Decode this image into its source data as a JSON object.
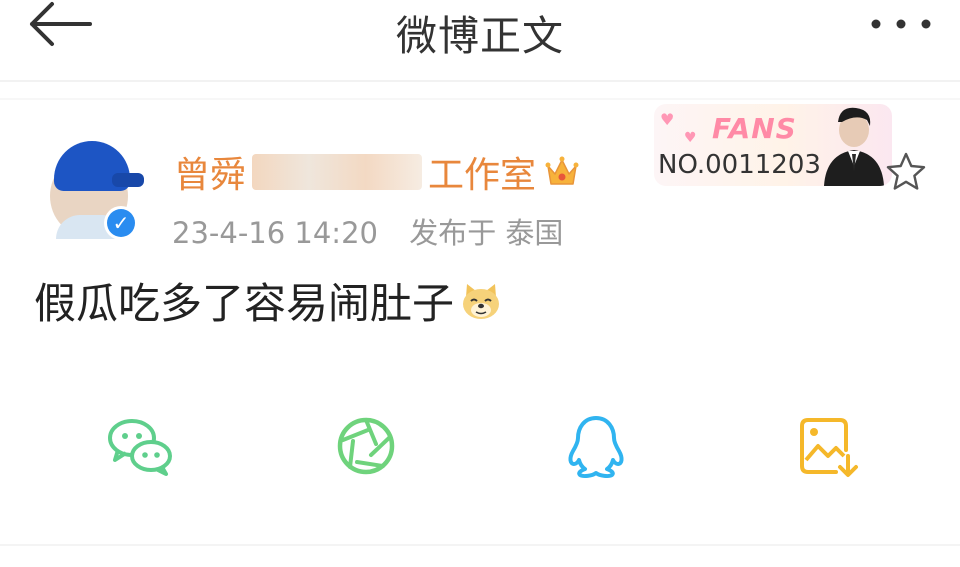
{
  "nav": {
    "title": "微博正文",
    "back_icon": "arrow-left-icon",
    "more_icon": "more-dots-icon"
  },
  "post": {
    "author": {
      "name_prefix": "曾舜",
      "name_suffix": "工作室",
      "name_color": "#e8873c",
      "verified": true,
      "badge_icon": "crown-icon"
    },
    "meta": {
      "time": "23-4-16 14:20",
      "location": "发布于 泰国"
    },
    "fans_card": {
      "label": "FANS",
      "number": "NO.0011203"
    },
    "text": "假瓜吃多了容易闹肚子",
    "emoji": "doge-icon"
  },
  "share": {
    "items": [
      {
        "name": "wechat-icon",
        "color": "#5fcf8c"
      },
      {
        "name": "moments-icon",
        "color": "#6fd37c"
      },
      {
        "name": "qq-icon",
        "color": "#30b4f0"
      },
      {
        "name": "save-image-icon",
        "color": "#f5b82a"
      }
    ]
  }
}
